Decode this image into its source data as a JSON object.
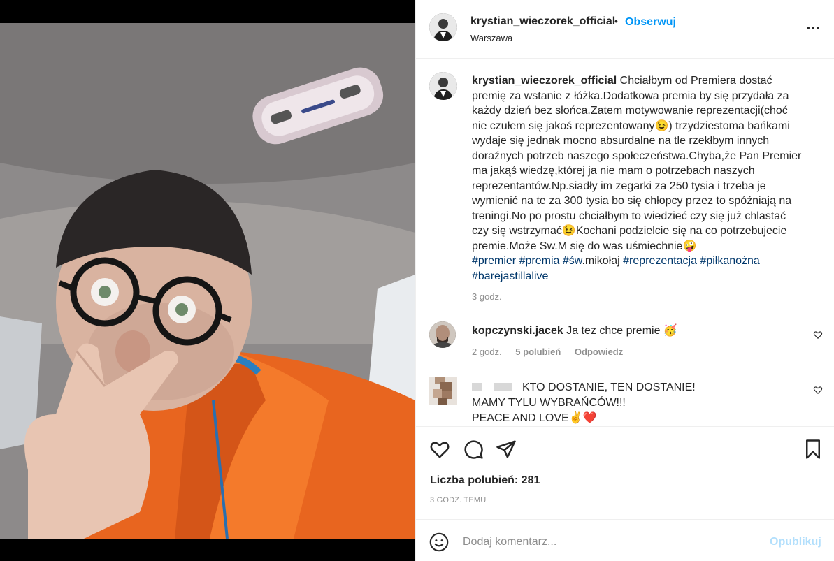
{
  "post": {
    "username": "krystian_wieczorek_official",
    "dot": "•",
    "follow_label": "Obserwuj",
    "location": "Warszawa",
    "more_icon": "more-horizontal-icon"
  },
  "caption": {
    "username": "krystian_wieczorek_official",
    "lines": [
      "Chciałbym od Premiera dostać",
      "premię za wstanie z łóżka.Dodatkowa premia by się przydała za",
      "każdy dzień bez słońca.Zatem motywowanie reprezentacji(choć",
      "nie czułem się jakoś reprezentowany😉) trzydziestoma bańkami",
      "wydaje się jednak mocno absurdalne na tle rzekłbym innych",
      "doraźnych potrzeb naszego społeczeństwa.Chyba,że Pan Premier",
      "ma jakąś wiedzę,której ja nie mam o potrzebach naszych",
      "reprezentantów.Np.siadły im zegarki za 250 tysia i trzeba je",
      "wymienić na te za 300 tysia bo się chłopcy przez to spóźniają na",
      "treningi.No po prostu chciałbym to wiedzieć czy się już chlastać",
      "czy się wstrzymać😉Kochani podzielcie się na co potrzebujecie",
      "premie.Może Sw.M się do was uśmiechnie🤪"
    ],
    "hashtags_line1": [
      "#premier",
      "#premia",
      "#św"
    ],
    "hashtag_plain": ".mikołaj",
    "hashtags_line1b": [
      "#reprezentacja",
      "#piłkanożna"
    ],
    "hashtags_line2": [
      "#barejastillalive"
    ],
    "time": "3 godz."
  },
  "comments": [
    {
      "username": "kopczynski.jacek",
      "text": "Ja tez chce premie 🥳",
      "time": "2 godz.",
      "likes": "5 polubień",
      "reply": "Odpowiedz"
    },
    {
      "username": "",
      "lines": [
        "KTO DOSTANIE, TEN DOSTANIE!",
        "MAMY TYLU WYBRAŃCÓW!!!",
        "PEACE AND LOVE✌️❤️"
      ]
    }
  ],
  "actions": {
    "like_icon": "heart-icon",
    "comment_icon": "comment-icon",
    "share_icon": "send-icon",
    "save_icon": "bookmark-icon",
    "likes_text": "Liczba polubień: 281",
    "time_ago": "3 GODZ. TEMU"
  },
  "add_comment": {
    "placeholder": "Dodaj komentarz...",
    "post_label": "Opublikuj",
    "emoji_icon": "smiley-icon"
  },
  "colors": {
    "accent": "#0095f6",
    "hashtag": "#00376b",
    "muted": "#8e8e8e",
    "post_disabled": "#b2dffc"
  }
}
